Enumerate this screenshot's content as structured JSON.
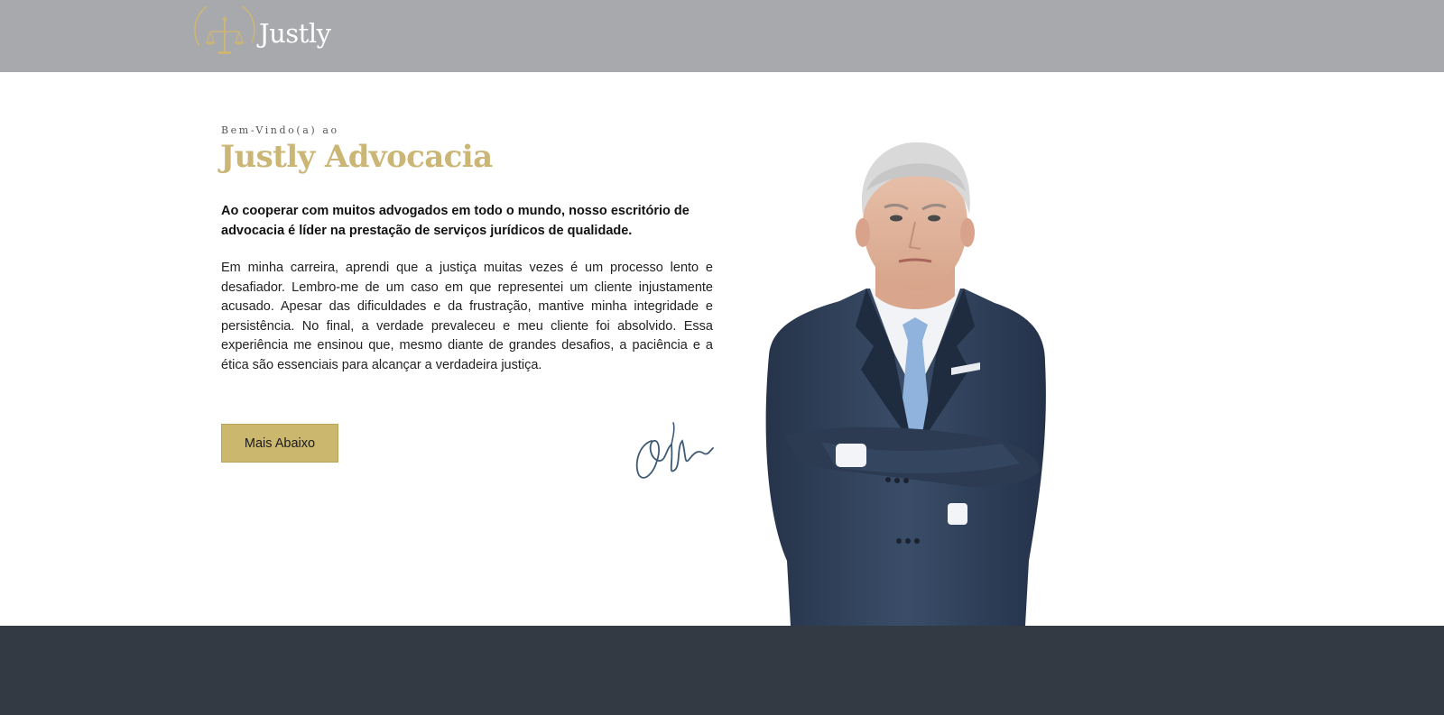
{
  "header": {
    "logo_text": "Justly",
    "logo_icon": "scales-of-justice-icon",
    "background_color": "#a8a9ad"
  },
  "hero": {
    "eyebrow": "Bem-Vindo(a) ao",
    "title": "Justly Advocacia",
    "lead": "Ao cooperar com muitos advogados em todo o mundo, nosso escritório de advocacia é líder na prestação de serviços jurídicos de qualidade.",
    "body": "Em minha carreira, aprendi que a justiça muitas vezes é um processo lento e desafiador. Lembro-me de um caso em que representei um cliente injustamente acusado. Apesar das dificuldades e da frustração, mantive minha integridade e persistência. No final, a verdade prevaleceu e meu cliente foi absolvido. Essa experiência me ensinou que, mesmo diante de grandes desafios, a paciência e a ética são essenciais para alcançar a verdadeira justiça.",
    "cta_label": "Mais Abaixo",
    "signature_icon": "handwritten-signature",
    "portrait_icon": "lawyer-portrait-image"
  },
  "colors": {
    "gold_accent": "#cbb676",
    "button": "#cbb76d",
    "footer": "#343a44",
    "suit": "#2f3f55"
  }
}
